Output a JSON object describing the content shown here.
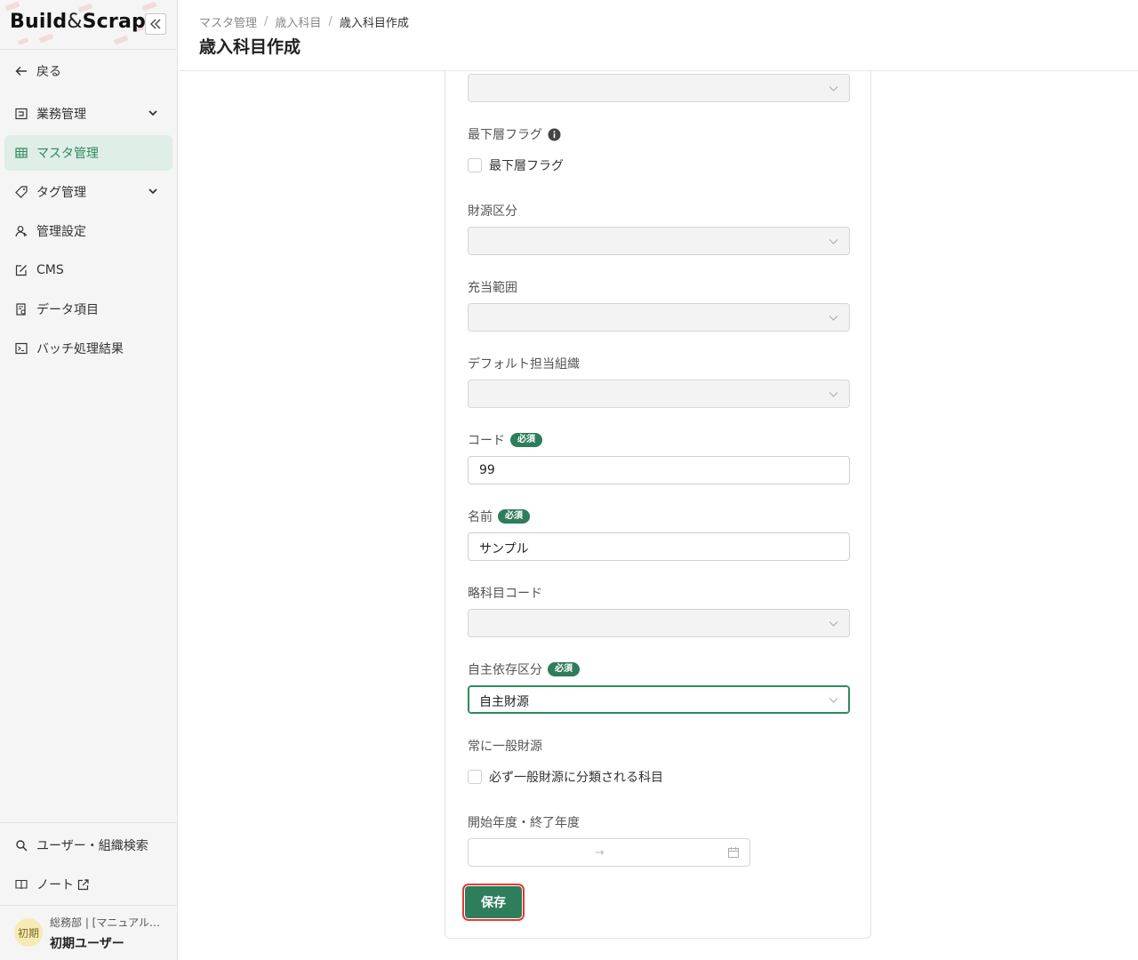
{
  "app": {
    "logo_left": "Build",
    "logo_amp": "&",
    "logo_right": "Scrap"
  },
  "sidebar": {
    "back_label": "戻る",
    "items": [
      {
        "label": "業務管理",
        "icon": "business-icon",
        "has_chevron": true
      },
      {
        "label": "マスタ管理",
        "icon": "table-icon",
        "active": true
      },
      {
        "label": "タグ管理",
        "icon": "tag-icon",
        "has_chevron": true
      },
      {
        "label": "管理設定",
        "icon": "users-settings-icon"
      },
      {
        "label": "CMS",
        "icon": "edit-icon"
      },
      {
        "label": "データ項目",
        "icon": "data-item-icon"
      },
      {
        "label": "バッチ処理結果",
        "icon": "terminal-icon"
      }
    ],
    "bottom_items": [
      {
        "label": "ユーザー・組織検索",
        "icon": "search-icon"
      },
      {
        "label": "ノート",
        "icon": "book-icon",
        "external": true
      }
    ],
    "user": {
      "avatar_text": "初期",
      "org": "総務部 | [マニュアル…",
      "name": "初期ユーザー"
    }
  },
  "header": {
    "breadcrumb": [
      "マスタ管理",
      "歳入科目",
      "歳入科目作成"
    ],
    "title": "歳入科目作成"
  },
  "form": {
    "top_select": {
      "value": ""
    },
    "lowest_flag": {
      "label": "最下層フラグ",
      "checkbox_label": "最下層フラグ",
      "checked": false
    },
    "fund_category": {
      "label": "財源区分",
      "value": ""
    },
    "allocation_range": {
      "label": "充当範囲",
      "value": ""
    },
    "default_org": {
      "label": "デフォルト担当組織",
      "value": ""
    },
    "code": {
      "label": "コード",
      "required_badge": "必須",
      "value": "99"
    },
    "name": {
      "label": "名前",
      "required_badge": "必須",
      "value": "サンプル"
    },
    "short_code": {
      "label": "略科目コード",
      "value": ""
    },
    "dependency": {
      "label": "自主依存区分",
      "required_badge": "必須",
      "value": "自主財源"
    },
    "general_fund": {
      "label": "常に一般財源",
      "checkbox_label": "必ず一般財源に分類される科目",
      "checked": false
    },
    "fiscal_year_range": {
      "label": "開始年度・終了年度",
      "separator": "→"
    },
    "save_label": "保存"
  },
  "colors": {
    "accent": "#2e7d5b",
    "active_nav_bg": "#dfeee6",
    "focus_outline": "#e53935"
  }
}
